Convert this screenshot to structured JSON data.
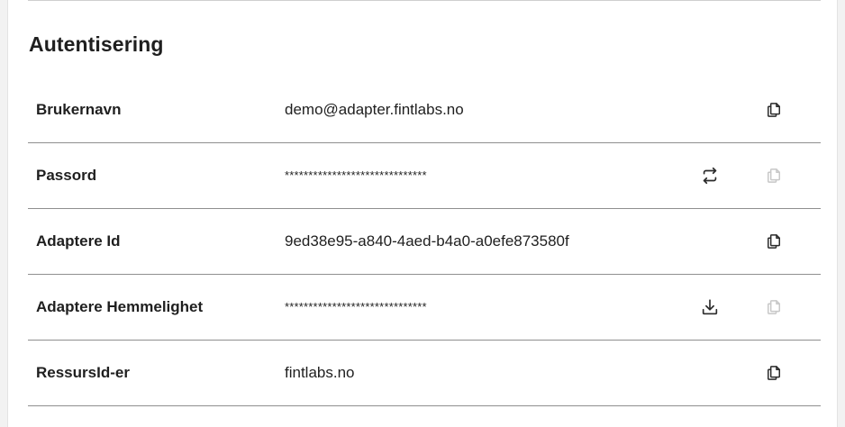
{
  "section": {
    "title": "Autentisering"
  },
  "rows": [
    {
      "label": "Brukernavn",
      "value": "demo@adapter.fintlabs.no",
      "masked": false,
      "action_icon": null,
      "copy_icon": "copy-icon",
      "copy_enabled": true
    },
    {
      "label": "Passord",
      "value": "******************************",
      "masked": true,
      "action_icon": "refresh-icon",
      "copy_icon": "copy-icon",
      "copy_enabled": false
    },
    {
      "label": "Adaptere Id",
      "value": "9ed38e95-a840-4aed-b4a0-a0efe873580f",
      "masked": false,
      "action_icon": null,
      "copy_icon": "copy-icon",
      "copy_enabled": true
    },
    {
      "label": "Adaptere Hemmelighet",
      "value": "******************************",
      "masked": true,
      "action_icon": "download-icon",
      "copy_icon": "copy-icon",
      "copy_enabled": false
    },
    {
      "label": "RessursId-er",
      "value": "fintlabs.no",
      "masked": false,
      "action_icon": null,
      "copy_icon": "copy-icon",
      "copy_enabled": true
    }
  ],
  "colors": {
    "icon_enabled": "#2b2b2b",
    "icon_disabled": "#c8c8c8",
    "divider": "#8f8f8f"
  }
}
